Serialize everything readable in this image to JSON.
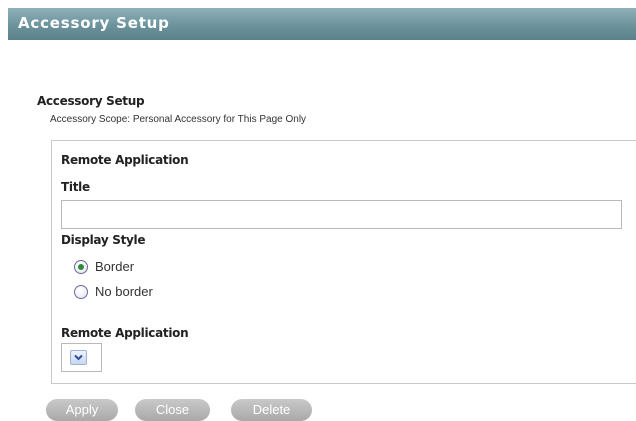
{
  "header": {
    "title": "Accessory Setup"
  },
  "section": {
    "heading": "Accessory Setup",
    "scope": "Accessory Scope: Personal Accessory for This Page Only"
  },
  "panel": {
    "heading": "Remote Application",
    "title_label": "Title",
    "title_value": "",
    "display_style_label": "Display Style",
    "display_style_options": [
      {
        "label": "Border",
        "checked": true
      },
      {
        "label": "No border",
        "checked": false
      }
    ],
    "remote_app_label": "Remote Application",
    "remote_app_selected": ""
  },
  "buttons": {
    "apply": "Apply",
    "close": "Close",
    "delete": "Delete"
  },
  "colors": {
    "header_bar": "#6c939c",
    "button_bg": "#b5b5b5",
    "radio_selected": "#2c8a3a"
  },
  "icons": {
    "dropdown": "chevron-down-icon"
  }
}
